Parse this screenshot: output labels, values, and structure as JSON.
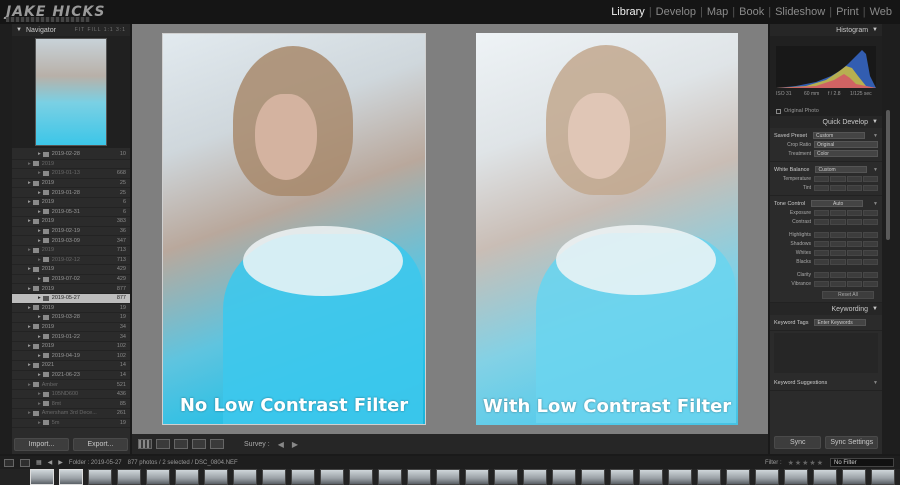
{
  "brand": {
    "logo": "JAKE HICKS"
  },
  "modules": [
    "Library",
    "Develop",
    "Map",
    "Book",
    "Slideshow",
    "Print",
    "Web"
  ],
  "active_module": "Library",
  "navigator": {
    "title": "Navigator",
    "options": "FIT FILL 1:1 3:1"
  },
  "folders": [
    {
      "name": "2019-02-28",
      "count": "10",
      "level": 2
    },
    {
      "name": "2019",
      "count": "",
      "level": 1,
      "dim": true
    },
    {
      "name": "2019-01-13",
      "count": "668",
      "level": 2,
      "dim": true
    },
    {
      "name": "2019",
      "count": "25",
      "level": 1
    },
    {
      "name": "2019-01-28",
      "count": "25",
      "level": 2
    },
    {
      "name": "2019",
      "count": "6",
      "level": 1
    },
    {
      "name": "2019-05-31",
      "count": "6",
      "level": 2
    },
    {
      "name": "2019",
      "count": "383",
      "level": 1
    },
    {
      "name": "2019-02-19",
      "count": "36",
      "level": 2
    },
    {
      "name": "2019-03-09",
      "count": "347",
      "level": 2
    },
    {
      "name": "2019",
      "count": "713",
      "level": 1,
      "dim": true
    },
    {
      "name": "2019-02-12",
      "count": "713",
      "level": 2,
      "dim": true
    },
    {
      "name": "2019",
      "count": "429",
      "level": 1
    },
    {
      "name": "2019-07-02",
      "count": "429",
      "level": 2
    },
    {
      "name": "2019",
      "count": "877",
      "level": 1
    },
    {
      "name": "2019-05-27",
      "count": "877",
      "level": 2,
      "selected": true
    },
    {
      "name": "2019",
      "count": "19",
      "level": 1
    },
    {
      "name": "2019-03-28",
      "count": "19",
      "level": 2
    },
    {
      "name": "2019",
      "count": "34",
      "level": 1
    },
    {
      "name": "2019-01-22",
      "count": "34",
      "level": 2
    },
    {
      "name": "2019",
      "count": "102",
      "level": 1
    },
    {
      "name": "2019-04-19",
      "count": "102",
      "level": 2
    },
    {
      "name": "2021",
      "count": "14",
      "level": 1
    },
    {
      "name": "2021-06-23",
      "count": "14",
      "level": 2
    },
    {
      "name": "Amber",
      "count": "521",
      "level": 1,
      "dim": true
    },
    {
      "name": "105ND600",
      "count": "436",
      "level": 2,
      "dim": true
    },
    {
      "name": "8mt",
      "count": "85",
      "level": 2,
      "dim": true
    },
    {
      "name": "Amersham 3rd Dece...",
      "count": "261",
      "level": 1,
      "dim": true
    },
    {
      "name": "5m",
      "count": "19",
      "level": 2,
      "dim": true
    },
    {
      "name": "amersham april 2016",
      "count": "338",
      "level": 1,
      "dim": true
    }
  ],
  "left_buttons": {
    "import": "Import...",
    "export": "Export..."
  },
  "captions": {
    "left": "No Low Contrast Filter",
    "right": "With Low Contrast Filter"
  },
  "toolbar": {
    "survey": "Survey :"
  },
  "histogram": {
    "title": "Histogram",
    "iso": "ISO 31",
    "focal": "60 mm",
    "aperture": "f / 2.8",
    "shutter": "1/125 sec",
    "original_photo": "Original Photo"
  },
  "quick_develop": {
    "title": "Quick Develop",
    "saved_preset_label": "Saved Preset",
    "saved_preset_value": "Custom",
    "crop_label": "Crop Ratio",
    "crop_value": "Original",
    "treatment_label": "Treatment",
    "treatment_value": "Color",
    "wb_label": "White Balance",
    "wb_value": "Custom",
    "temperature": "Temperature",
    "tint": "Tint",
    "tone_label": "Tone Control",
    "tone_value": "Auto",
    "exposure": "Exposure",
    "contrast": "Contrast",
    "highlights": "Highlights",
    "shadows": "Shadows",
    "whites": "Whites",
    "blacks": "Blacks",
    "clarity": "Clarity",
    "vibrance": "Vibrance",
    "reset": "Reset All"
  },
  "keywording": {
    "title": "Keywording",
    "tags_label": "Keyword Tags",
    "tags_value": "Enter Keywords",
    "suggestions": "Keyword Suggestions"
  },
  "right_buttons": {
    "sync": "Sync",
    "sync_settings": "Sync Settings"
  },
  "filmbar": {
    "folder": "Folder : 2019-05-27",
    "count": "877 photos / 2 selected / DSC_0804.NEF",
    "filter_label": "Filter :",
    "filter_value": "No Filter"
  },
  "colors": {
    "accent_cyan": "#3cc6e8",
    "panel": "#2b2b2b",
    "canvas": "#7f7f7f"
  }
}
